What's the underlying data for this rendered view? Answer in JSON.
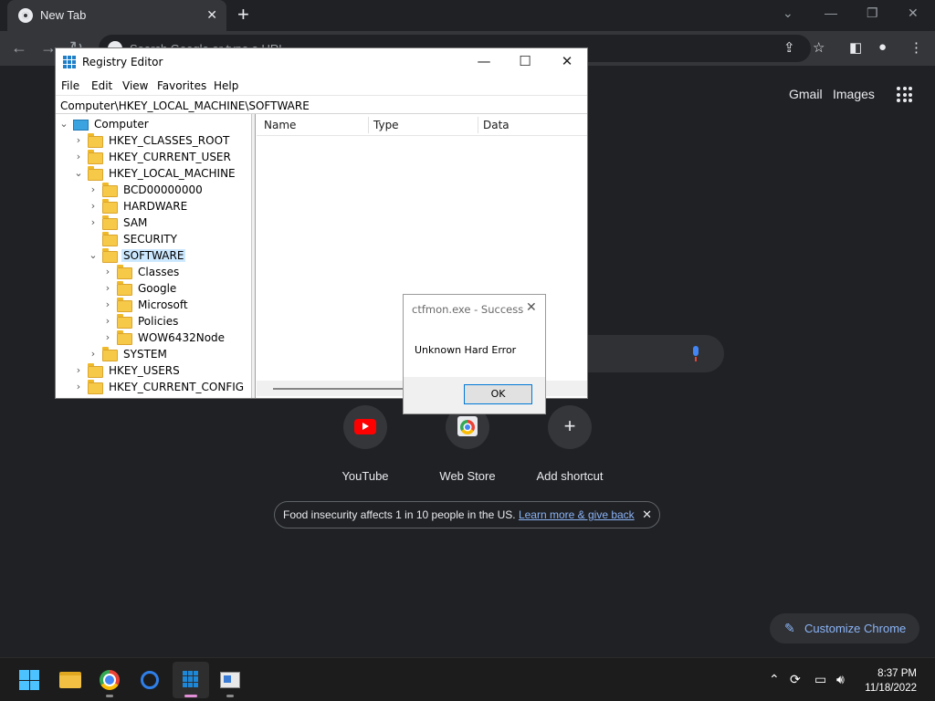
{
  "chrome": {
    "tab_title": "New Tab",
    "omnibox_placeholder": "Search Google or type a URL",
    "ntp": {
      "gmail": "Gmail",
      "images": "Images",
      "shortcuts": [
        {
          "label": "YouTube"
        },
        {
          "label": "Web Store"
        },
        {
          "label": "Add shortcut"
        }
      ],
      "promo": {
        "text": "Food insecurity affects 1 in 10 people in the US.",
        "link": "Learn more & give back"
      },
      "customize": "Customize Chrome"
    }
  },
  "regedit": {
    "title": "Registry Editor",
    "menu": [
      "File",
      "Edit",
      "View",
      "Favorites",
      "Help"
    ],
    "address": "Computer\\HKEY_LOCAL_MACHINE\\SOFTWARE",
    "columns": [
      "Name",
      "Type",
      "Data"
    ],
    "tree": [
      {
        "label": "Computer",
        "chev": "⌄",
        "icon": "computer"
      },
      {
        "label": "HKEY_CLASSES_ROOT",
        "chev": "›"
      },
      {
        "label": "HKEY_CURRENT_USER",
        "chev": "›"
      },
      {
        "label": "HKEY_LOCAL_MACHINE",
        "chev": "⌄"
      },
      {
        "label": "BCD00000000",
        "chev": "›"
      },
      {
        "label": "HARDWARE",
        "chev": "›"
      },
      {
        "label": "SAM",
        "chev": "›"
      },
      {
        "label": "SECURITY",
        "chev": ""
      },
      {
        "label": "SOFTWARE",
        "chev": "⌄",
        "selected": true
      },
      {
        "label": "Classes",
        "chev": "›"
      },
      {
        "label": "Google",
        "chev": "›"
      },
      {
        "label": "Microsoft",
        "chev": "›"
      },
      {
        "label": "Policies",
        "chev": "›"
      },
      {
        "label": "WOW6432Node",
        "chev": "›"
      },
      {
        "label": "SYSTEM",
        "chev": "›"
      },
      {
        "label": "HKEY_USERS",
        "chev": "›"
      },
      {
        "label": "HKEY_CURRENT_CONFIG",
        "chev": "›"
      }
    ]
  },
  "dialog": {
    "title": "ctfmon.exe - Success",
    "message": "Unknown Hard Error",
    "ok": "OK"
  },
  "taskbar": {
    "time": "8:37 PM",
    "date": "11/18/2022"
  },
  "colors": {
    "chrome_bg": "#202124",
    "chrome_toolbar": "#35363a",
    "link_blue": "#8ab4f8",
    "selection": "#cce8ff",
    "folder_yellow": "#f7c948",
    "dialog_focus": "#0078d7"
  }
}
